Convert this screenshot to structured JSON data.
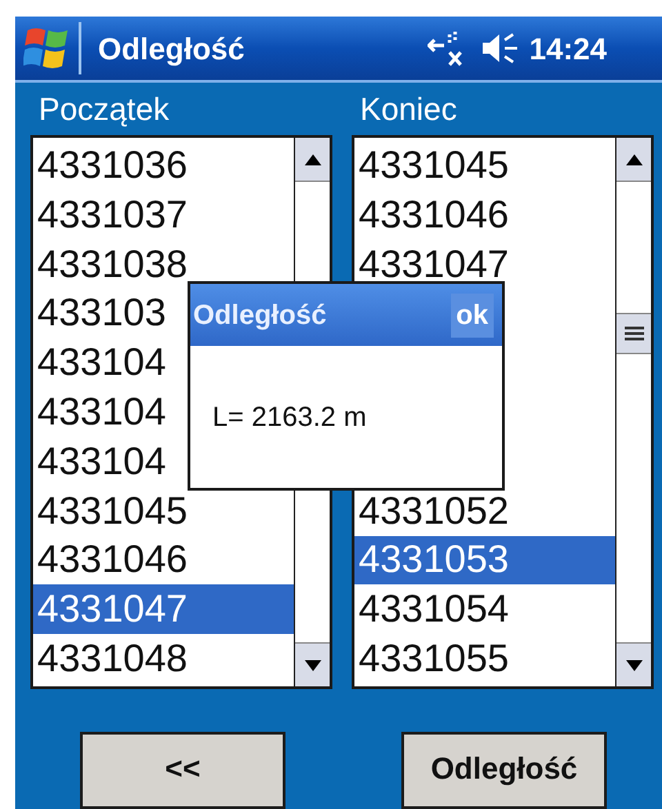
{
  "title_bar": {
    "title": "Odległość",
    "time": "14:24"
  },
  "lists": [
    {
      "label": "Początek",
      "items": [
        {
          "text": "4331036",
          "selected": false
        },
        {
          "text": "4331037",
          "selected": false
        },
        {
          "text": "4331038",
          "selected": false
        },
        {
          "text": "433103",
          "selected": false
        },
        {
          "text": "433104",
          "selected": false
        },
        {
          "text": "433104",
          "selected": false
        },
        {
          "text": "433104",
          "selected": false
        },
        {
          "text": "4331045",
          "selected": false
        },
        {
          "text": "4331046",
          "selected": false
        },
        {
          "text": "4331047",
          "selected": true
        },
        {
          "text": "4331048",
          "selected": false
        }
      ]
    },
    {
      "label": "Koniec",
      "items": [
        {
          "text": "4331045",
          "selected": false
        },
        {
          "text": "4331046",
          "selected": false
        },
        {
          "text": "4331047",
          "selected": false
        },
        {
          "selected": false
        },
        {
          "selected": false
        },
        {
          "selected": false
        },
        {
          "selected": false
        },
        {
          "text": "4331052",
          "selected": false
        },
        {
          "text": "4331053",
          "selected": true
        },
        {
          "text": "4331054",
          "selected": false
        },
        {
          "text": "4331055",
          "selected": false
        }
      ]
    }
  ],
  "dialog": {
    "title": "Odległość",
    "ok": "ok",
    "message": "L= 2163.2 m"
  },
  "buttons": [
    "<<",
    "Odległość"
  ]
}
